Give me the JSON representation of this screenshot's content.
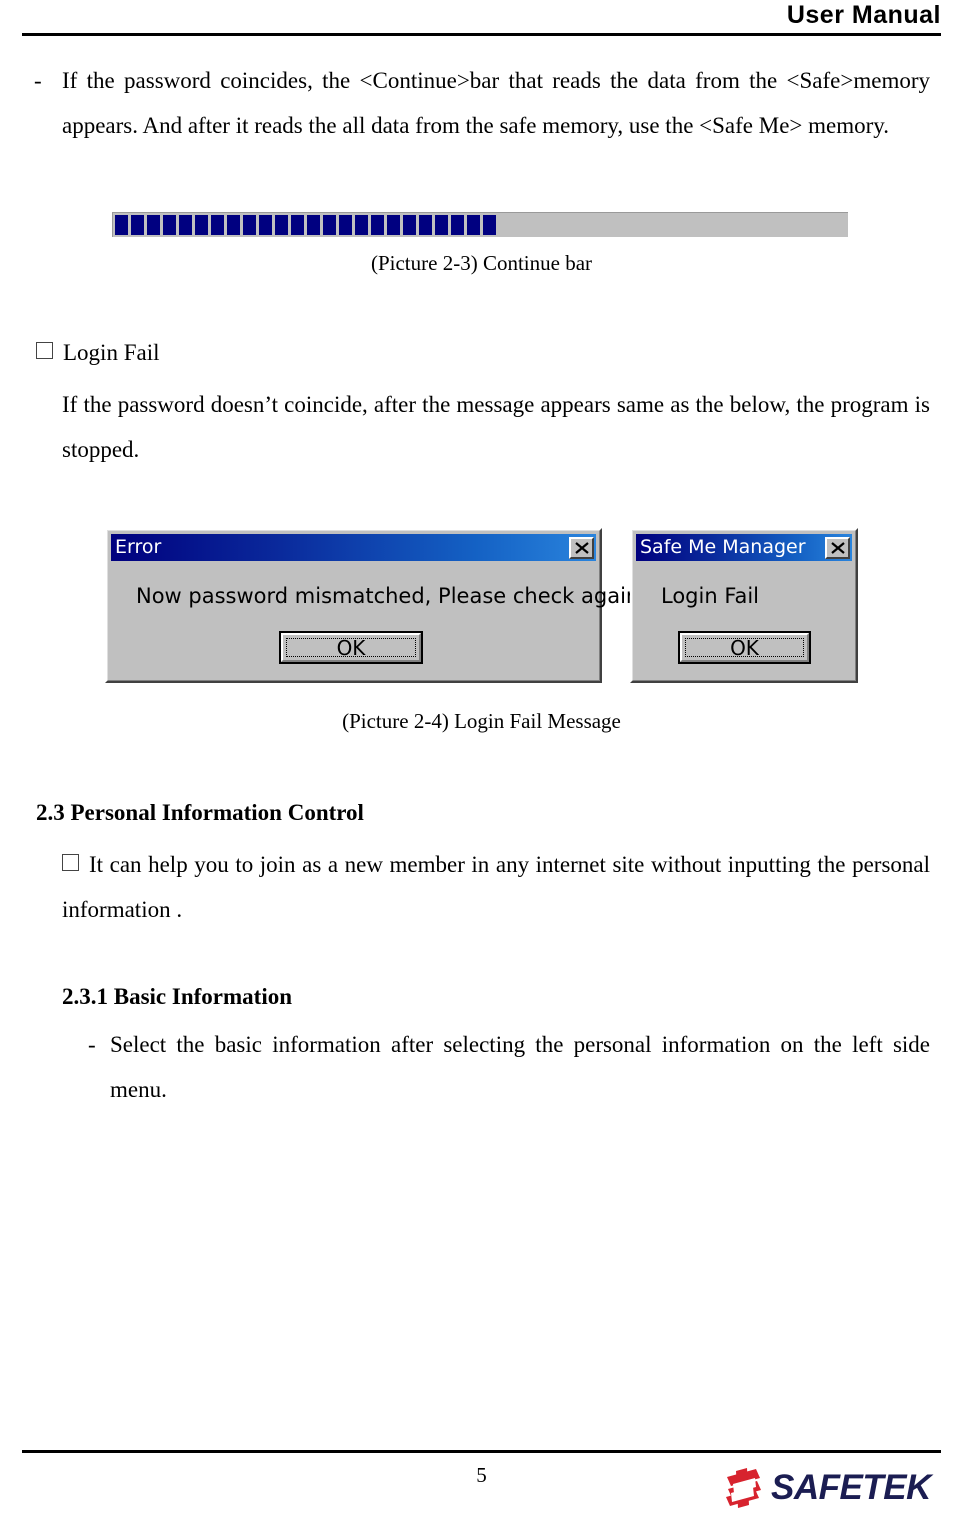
{
  "header": {
    "title": "User Manual"
  },
  "footer": {
    "page_number": "5",
    "logo_text": "SAFETEK",
    "logo_mark_color": "#d7232e",
    "logo_text_color": "#1b1d52"
  },
  "body": {
    "para1_dash": "-",
    "para1": "If the password coincides, the <Continue>bar that reads the data from the <Safe>memory appears. And after it reads the all data from the safe memory, use the <Safe Me> memory.",
    "caption_2_3": "(Picture 2-3) Continue bar",
    "login_fail_heading": "Login Fail",
    "login_fail_para": "If the password doesn’t coincide, after the message appears same as the below, the program is stopped.",
    "caption_2_4": "(Picture 2-4) Login Fail Message",
    "section_2_3_heading": "2.3 Personal Information Control",
    "section_2_3_bullet": "It can help you to join as a new member in any internet site without inputting the personal information .",
    "section_2_3_1_heading": "2.3.1 Basic Information",
    "section_2_3_1_dash": "-",
    "section_2_3_1_para": "Select the basic information after selecting the personal information on the left side menu."
  },
  "progress_bar": {
    "segment_count": 24,
    "fill_color": "#000080",
    "track_color": "#c0c0c0",
    "percent_filled": "51"
  },
  "dialogs": [
    {
      "id": "error-dialog",
      "title": "Error",
      "message": "Now password mismatched, Please check again,",
      "button_label": "OK",
      "close_label": "✕"
    },
    {
      "id": "safe-me-manager-dialog",
      "title": "Safe Me Manager",
      "message": "Login Fail",
      "button_label": "OK",
      "close_label": "✕"
    }
  ]
}
